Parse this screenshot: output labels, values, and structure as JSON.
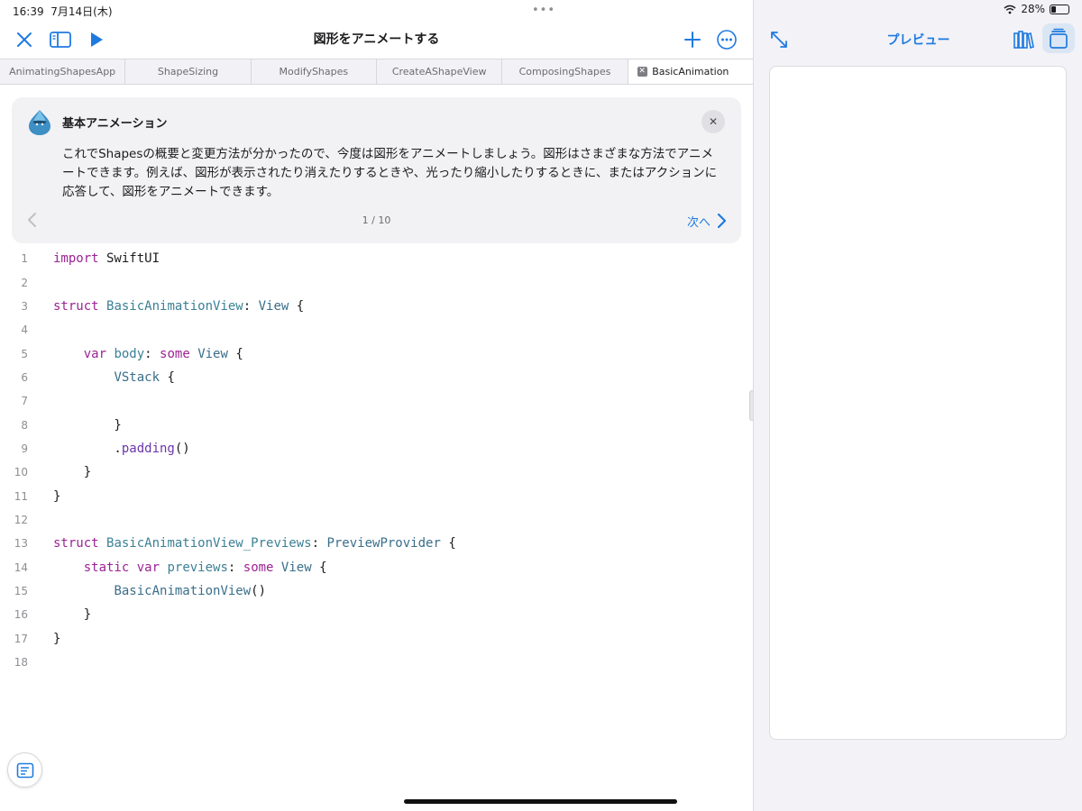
{
  "status_bar": {
    "time": "16:39",
    "date": "7月14日(木)",
    "multitask_dots": "•••",
    "battery_percent": "28%",
    "battery_level": 0.28
  },
  "toolbar": {
    "title": "図形をアニメートする",
    "icons": [
      "close-icon",
      "sidebar-icon",
      "play-icon",
      "plus-icon",
      "more-icon"
    ]
  },
  "tabs": [
    {
      "label": "AnimatingShapesApp",
      "active": false
    },
    {
      "label": "ShapeSizing",
      "active": false
    },
    {
      "label": "ModifyShapes",
      "active": false
    },
    {
      "label": "CreateAShapeView",
      "active": false
    },
    {
      "label": "ComposingShapes",
      "active": false
    },
    {
      "label": "BasicAnimation",
      "active": true
    }
  ],
  "guide": {
    "title": "基本アニメーション",
    "body": "これでShapesの概要と変更方法が分かったので、今度は図形をアニメートしましょう。図形はさまざまな方法でアニメートできます。例えば、図形が表示されたり消えたりするときや、光ったり縮小したりするときに、またはアクションに応答して、図形をアニメートできます。",
    "page": "1 / 10",
    "next_label": "次へ"
  },
  "code": {
    "line_numbers": [
      "1",
      "2",
      "3",
      "4",
      "5",
      "6",
      "7",
      "8",
      "9",
      "10",
      "11",
      "12",
      "13",
      "14",
      "15",
      "16",
      "17",
      "18"
    ]
  },
  "preview": {
    "title": "プレビュー",
    "icons": [
      "expand-icon",
      "library-icon",
      "cards-icon"
    ]
  },
  "colors": {
    "accent": "#1f7ae0",
    "keyword": "#9b2393",
    "type": "#3a6e8a",
    "function": "#6c36a9"
  }
}
